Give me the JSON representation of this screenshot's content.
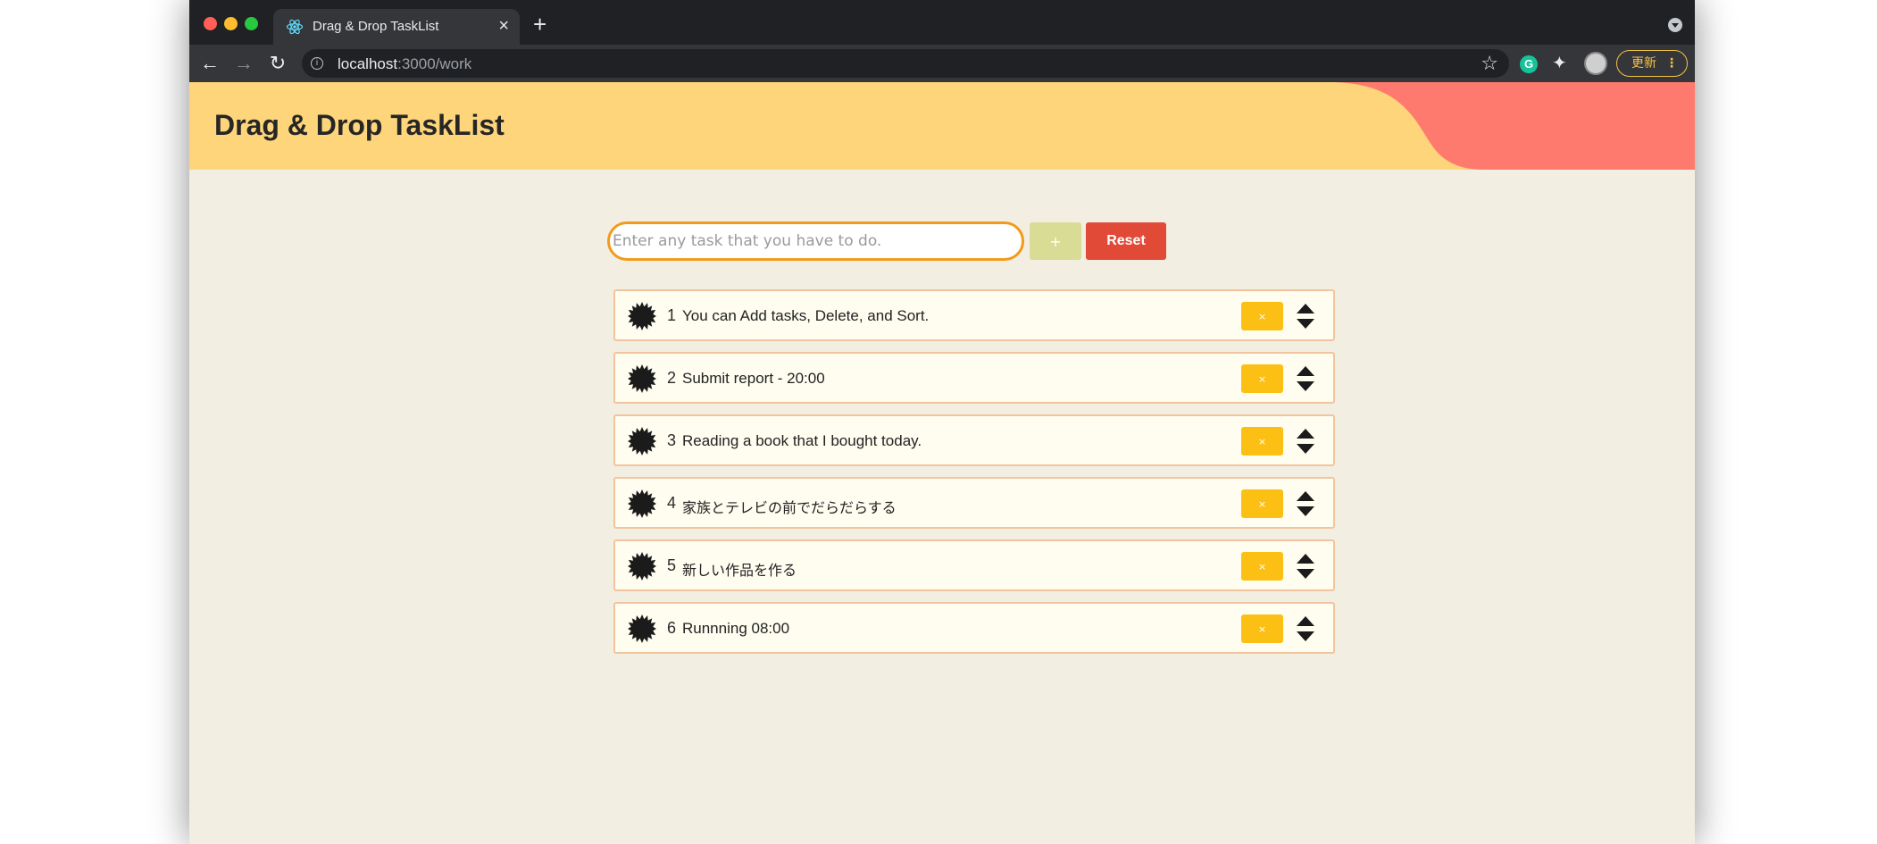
{
  "browser": {
    "tab_title": "Drag & Drop TaskList",
    "tab_close": "×",
    "new_tab": "+",
    "url_host": "localhost",
    "url_rest": ":3000/work",
    "update_label": "更新",
    "update_menu": "⋮",
    "extension_letter": "G"
  },
  "app": {
    "title": "Drag & Drop TaskList",
    "accent_header": "#fed57a",
    "accent_blob": "#ff7a6e"
  },
  "form": {
    "placeholder": "Enter any task that you have to do.",
    "value": "",
    "add_label": "+",
    "reset_label": "Reset"
  },
  "tasks": [
    {
      "num": "1",
      "text": "You can Add tasks, Delete, and Sort.",
      "delete_label": "×"
    },
    {
      "num": "2",
      "text": "Submit report - 20:00",
      "delete_label": "×"
    },
    {
      "num": "3",
      "text": "Reading a book that I bought today.",
      "delete_label": "×"
    },
    {
      "num": "4",
      "text": "家族とテレビの前でだらだらする",
      "delete_label": "×"
    },
    {
      "num": "5",
      "text": "新しい作品を作る",
      "delete_label": "×"
    },
    {
      "num": "6",
      "text": "Runnning 08:00",
      "delete_label": "×"
    }
  ]
}
